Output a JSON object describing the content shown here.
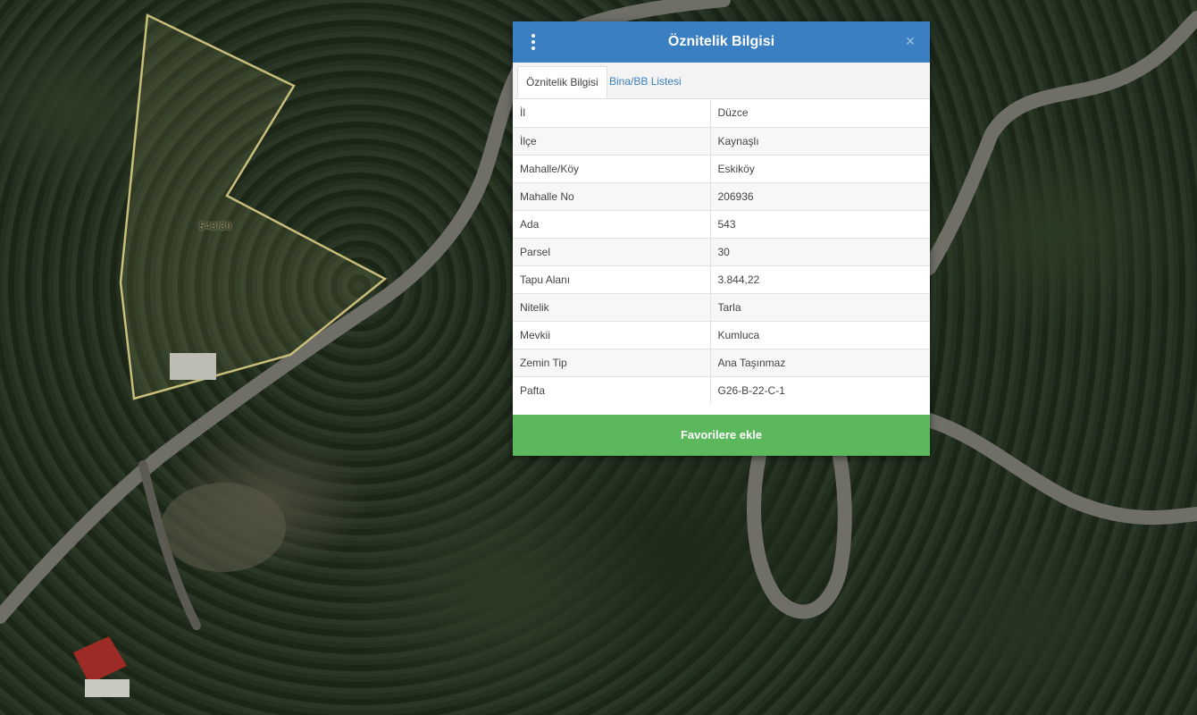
{
  "map": {
    "parcel_label": "543/30"
  },
  "panel": {
    "title": "Öznitelik Bilgisi",
    "close_symbol": "×",
    "menu_icon": "vertical-dots-icon",
    "tabs": [
      {
        "label": "Öznitelik Bilgisi",
        "active": true
      },
      {
        "label": "Bina/BB Listesi",
        "active": false
      }
    ],
    "rows": [
      {
        "key": "İl",
        "value": "Düzce"
      },
      {
        "key": "İlçe",
        "value": "Kaynaşlı"
      },
      {
        "key": "Mahalle/Köy",
        "value": "Eskiköy"
      },
      {
        "key": "Mahalle No",
        "value": "206936"
      },
      {
        "key": "Ada",
        "value": "543"
      },
      {
        "key": "Parsel",
        "value": "30"
      },
      {
        "key": "Tapu Alanı",
        "value": "3.844,22"
      },
      {
        "key": "Nitelik",
        "value": "Tarla"
      },
      {
        "key": "Mevkii",
        "value": "Kumluca"
      },
      {
        "key": "Zemin Tip",
        "value": "Ana Taşınmaz"
      },
      {
        "key": "Pafta",
        "value": "G26-B-22-C-1"
      }
    ],
    "favorite_button": "Favorilere ekle"
  },
  "colors": {
    "header": "#3a7fc1",
    "button": "#5cb85c",
    "parcel_outline": "#c8bd7a"
  }
}
